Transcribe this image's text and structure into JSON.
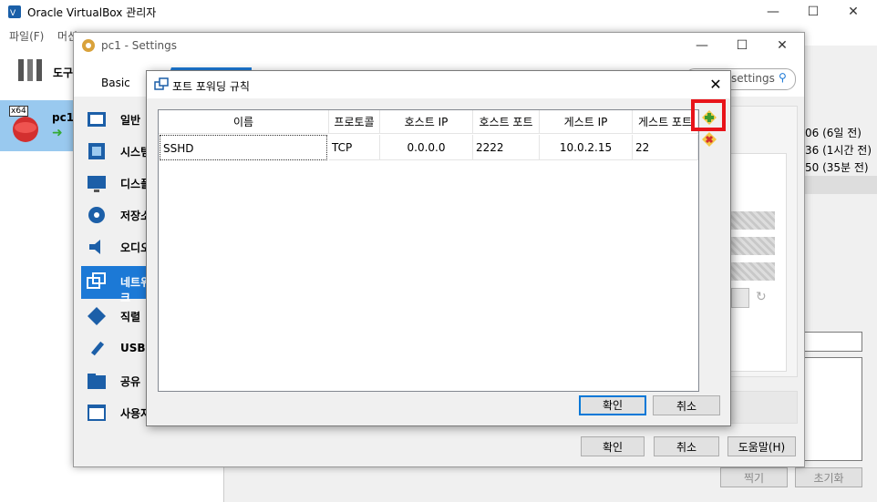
{
  "app": {
    "title": "Oracle VirtualBox 관리자",
    "menu": [
      "파일(F)",
      "머신"
    ],
    "tools_label": "도구",
    "vm_name": "pc1",
    "vm_badge": "x64",
    "snapshot_times": [
      "06 (6일 전)",
      "36 (1시간 전)",
      "50 (35분 전)"
    ],
    "bottom_buttons": {
      "take": "찍기",
      "reset": "초기화"
    }
  },
  "settings": {
    "title": "pc1 - Settings",
    "tab_basic": "Basic",
    "search_placeholder": "settings",
    "nav": [
      {
        "label": "일반",
        "icon": "general-icon"
      },
      {
        "label": "시스템",
        "icon": "system-icon"
      },
      {
        "label": "디스플",
        "icon": "display-icon"
      },
      {
        "label": "저장소",
        "icon": "storage-icon"
      },
      {
        "label": "오디오",
        "icon": "audio-icon"
      },
      {
        "label": "네트워크",
        "icon": "network-icon"
      },
      {
        "label": "직렬",
        "icon": "serial-icon"
      },
      {
        "label": "USB",
        "icon": "usb-icon"
      },
      {
        "label": "공유",
        "icon": "shared-folder-icon"
      },
      {
        "label": "사용자",
        "icon": "user-interface-icon"
      }
    ],
    "ok": "확인",
    "cancel": "취소",
    "help": "도움말(H)"
  },
  "port_forwarding": {
    "title": "포트 포워딩 규칙",
    "columns": [
      "이름",
      "프로토콜",
      "호스트 IP",
      "호스트 포트",
      "게스트 IP",
      "게스트 포트"
    ],
    "rows": [
      {
        "name": "SSHD",
        "protocol": "TCP",
        "host_ip": "0.0.0.0",
        "host_port": "2222",
        "guest_ip": "10.0.2.15",
        "guest_port": "22"
      }
    ],
    "ok": "확인",
    "cancel": "취소"
  },
  "colors": {
    "accent": "#1c79d6",
    "highlight_box": "#e8141a",
    "selection": "#99c9ef"
  }
}
